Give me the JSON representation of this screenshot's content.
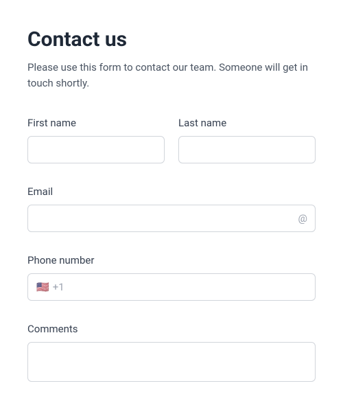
{
  "header": {
    "title": "Contact us",
    "subtitle": "Please use this form to contact our team. Someone will get in touch shortly."
  },
  "fields": {
    "first_name": {
      "label": "First name",
      "value": ""
    },
    "last_name": {
      "label": "Last name",
      "value": ""
    },
    "email": {
      "label": "Email",
      "value": "",
      "suffix_icon": "@"
    },
    "phone": {
      "label": "Phone number",
      "flag": "🇺🇸",
      "dial_code": "+1",
      "value": ""
    },
    "comments": {
      "label": "Comments",
      "value": ""
    }
  }
}
